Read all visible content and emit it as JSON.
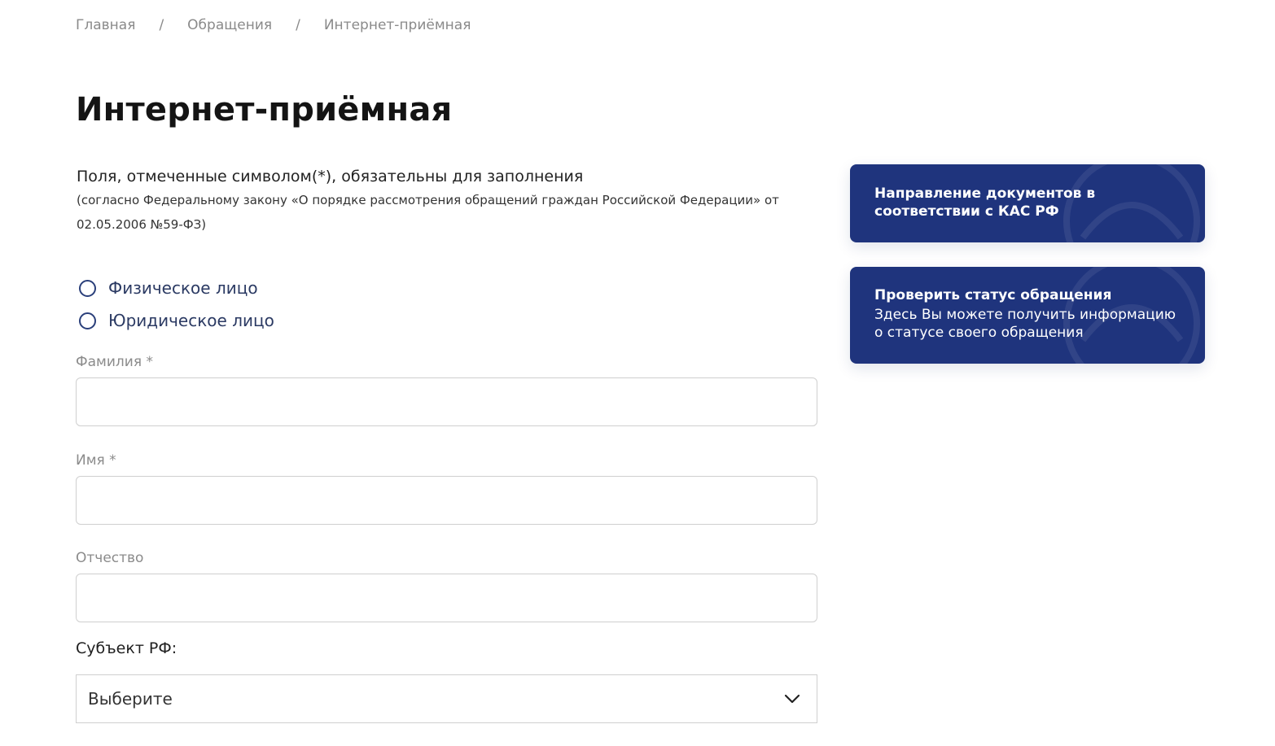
{
  "breadcrumb": {
    "items": [
      {
        "label": "Главная"
      },
      {
        "label": "Обращения"
      },
      {
        "label": "Интернет-приёмная"
      }
    ],
    "separator": "/"
  },
  "page": {
    "title": "Интернет-приёмная"
  },
  "notice": {
    "main": "Поля, отмеченные символом(*), обязательны для заполнения",
    "law": "(согласно Федеральному закону «О порядке рассмотрения обращений граждан Российской Федерации» от 02.05.2006 №59-ФЗ)"
  },
  "person_type": {
    "options": [
      {
        "label": "Физическое лицо",
        "selected": false
      },
      {
        "label": "Юридическое лицо",
        "selected": false
      }
    ]
  },
  "form": {
    "last_name": {
      "label": "Фамилия *",
      "value": ""
    },
    "first_name": {
      "label": "Имя *",
      "value": ""
    },
    "patronymic": {
      "label": "Отчество",
      "value": ""
    },
    "region": {
      "label": "Субъект РФ:",
      "selected": "Выберите"
    }
  },
  "sidebar": {
    "kas_card": {
      "title": "Направление документов в соответствии с КАС РФ"
    },
    "status_card": {
      "title": "Проверить статус обращения",
      "text": "Здесь Вы можете получить информацию о статусе своего обращения"
    }
  },
  "colors": {
    "card_bg": "#1f347d",
    "radio_border": "#2a3f7a",
    "input_border": "#cfcfcf"
  },
  "icons": {
    "region_select": "chevron-down-icon"
  }
}
